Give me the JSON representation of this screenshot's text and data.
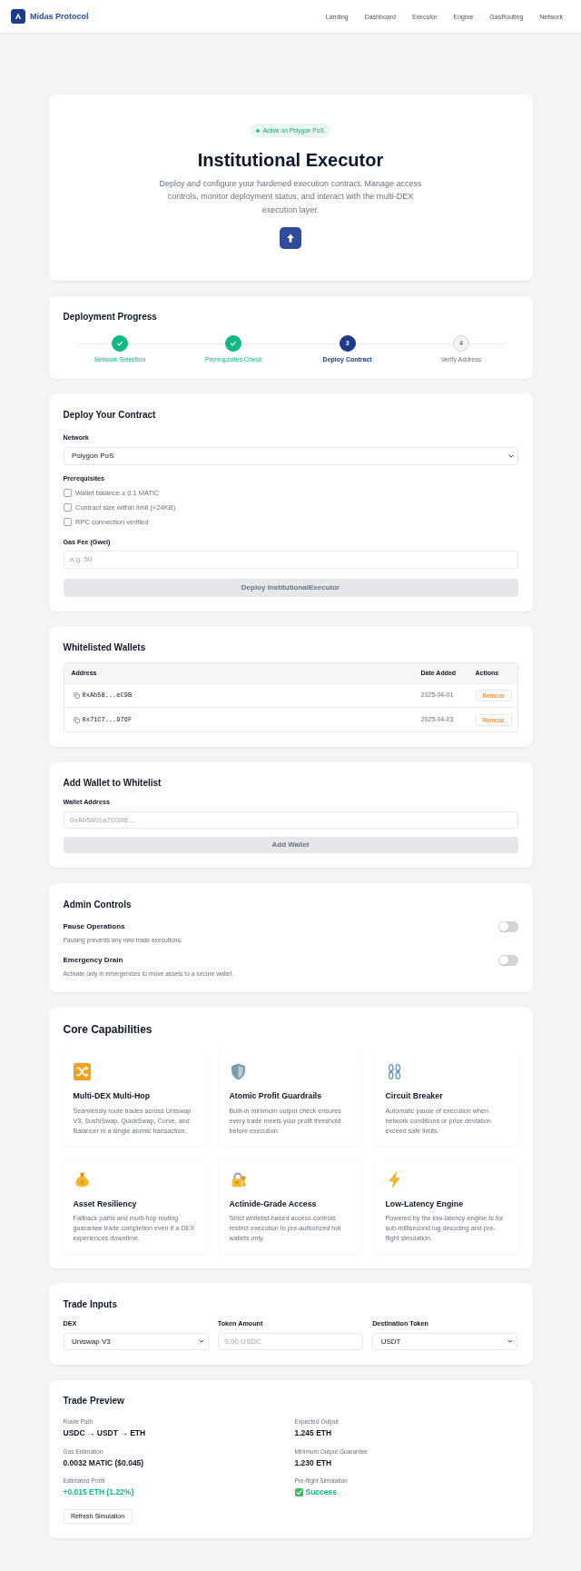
{
  "navbar": {
    "brand": "Midas Protocol",
    "links": [
      "Landing",
      "Dashboard",
      "Executor",
      "Engine",
      "GasRouting",
      "Network"
    ]
  },
  "hero": {
    "badge": "Active on Polygon PoS",
    "title": "Institutional Executor",
    "description": "Deploy and configure your hardened execution contract. Manage access controls, monitor deployment status, and interact with the multi-DEX execution layer."
  },
  "deployment_progress": {
    "title": "Deployment Progress",
    "steps": [
      {
        "label": "Network Selection",
        "completed": true,
        "current": false
      },
      {
        "label": "Prerequisites Check",
        "completed": true,
        "current": false
      },
      {
        "number": "3",
        "label": "Deploy Contract",
        "completed": false,
        "current": true
      },
      {
        "number": "4",
        "label": "Verify Address",
        "completed": false,
        "current": false
      }
    ]
  },
  "deploy_contract": {
    "title": "Deploy Your Contract",
    "network": {
      "label": "Network",
      "value": "Polygon PoS"
    },
    "prerequisites": {
      "label": "Prerequisites",
      "items": [
        {
          "label": "Wallet balance ≥ 0.1 MATIC",
          "checked": false
        },
        {
          "label": "Contract size within limit (<24KB)",
          "checked": false
        },
        {
          "label": "RPC connection verified",
          "checked": false
        }
      ]
    },
    "gas_fee": {
      "label": "Gas Fee (Gwei)",
      "placeholder": "e.g. 50"
    },
    "deploy_button": {
      "label": "Deploy InstitutionalExecutor",
      "disabled": true
    }
  },
  "whitelisted_wallets": {
    "title": "Whitelisted Wallets",
    "columns": [
      "Address",
      "Date Added",
      "Actions"
    ],
    "rows": [
      {
        "address": "0xAb58...eC9B",
        "date_added": "2025-04-01",
        "action": "Remove"
      },
      {
        "address": "0x71C7...976F",
        "date_added": "2025-04-03",
        "action": "Remove"
      }
    ]
  },
  "add_wallet": {
    "title": "Add Wallet to Whitelist",
    "field": {
      "label": "Wallet Address",
      "placeholder": "0xAb5801a7D398..."
    },
    "button": {
      "label": "Add Wallet",
      "disabled": true
    }
  },
  "admin_controls": {
    "title": "Admin Controls",
    "items": [
      {
        "label": "Pause Operations",
        "description": "Pausing prevents any new trade executions.",
        "on": false
      },
      {
        "label": "Emergency Drain",
        "description": "Activate only in emergencies to move assets to a secure wallet.",
        "on": false
      }
    ]
  },
  "core_capabilities": {
    "title": "Core Capabilities",
    "features": [
      {
        "title": "Multi-DEX Multi-Hop",
        "description": "Seamlessly route trades across Uniswap V3, SushiSwap, QuickSwap, Curve, and Balancer in a single atomic transaction."
      },
      {
        "title": "Atomic Profit Guardrails",
        "description": "Built-in minimum output check ensures every trade meets your profit threshold before execution."
      },
      {
        "title": "Circuit Breaker",
        "description": "Automatic pause of execution when network conditions or price deviation exceed safe limits."
      },
      {
        "title": "Asset Resiliency",
        "description": "Fallback paths and multi-hop routing guarantee trade completion even if a DEX experiences downtime."
      },
      {
        "title": "Actinide-Grade Access",
        "description": "Strict whitelist-based access controls restrict execution to pre-authorized hot wallets only."
      },
      {
        "title": "Low-Latency Engine",
        "description": "Powered by the low-latency-engine.ts for sub-millisecond log decoding and pre-flight simulation."
      }
    ]
  },
  "trade_inputs": {
    "title": "Trade Inputs",
    "fields": [
      {
        "kind": "select",
        "label": "DEX",
        "value": "Uniswap V3"
      },
      {
        "kind": "input",
        "label": "Token Amount",
        "placeholder": "0.00 USDC"
      },
      {
        "kind": "select",
        "label": "Destination Token",
        "value": "USDT"
      }
    ]
  },
  "trade_preview": {
    "title": "Trade Preview",
    "items": [
      {
        "kind": "plain",
        "label": "Route Path",
        "value": "USDC → USDT → ETH"
      },
      {
        "kind": "plain",
        "label": "Expected Output",
        "value": "1.245 ETH"
      },
      {
        "kind": "plain",
        "label": "Gas Estimation",
        "value": "0.0032 MATIC ($0.045)"
      },
      {
        "kind": "plain",
        "label": "Minimum Output Guarantee",
        "value": "1.230 ETH"
      },
      {
        "kind": "profit",
        "label": "Estimated Profit",
        "value": "+0.015 ETH (1.22%)"
      },
      {
        "kind": "status",
        "label": "Pre-flight Simulation",
        "value": "Success"
      }
    ],
    "button": "Refresh Simulation"
  }
}
